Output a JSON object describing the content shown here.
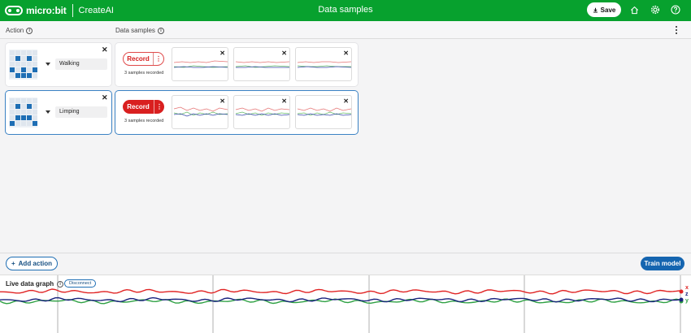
{
  "header": {
    "brand": "micro:bit",
    "product": "CreateAI",
    "title": "Data samples",
    "save_label": "Save"
  },
  "columns": {
    "action_label": "Action",
    "samples_label": "Data samples"
  },
  "actions": [
    {
      "name": "Walking",
      "record_label": "Record",
      "record_style": "outline",
      "samples_text": "3 samples recorded",
      "leds": [
        0,
        0,
        0,
        0,
        0,
        0,
        1,
        0,
        1,
        0,
        0,
        0,
        0,
        0,
        0,
        1,
        0,
        1,
        0,
        1,
        0,
        1,
        1,
        1,
        0
      ]
    },
    {
      "name": "Limping",
      "record_label": "Record",
      "record_style": "filled",
      "samples_text": "3 samples recorded",
      "leds": [
        0,
        0,
        0,
        0,
        0,
        0,
        1,
        0,
        1,
        0,
        0,
        0,
        0,
        0,
        0,
        0,
        1,
        1,
        1,
        0,
        1,
        0,
        0,
        0,
        1
      ]
    }
  ],
  "footer": {
    "add_action_label": "Add action",
    "train_label": "Train model"
  },
  "live_graph": {
    "title": "Live data graph",
    "disconnect_label": "Disconnect",
    "axes": [
      "x",
      "z",
      "y"
    ],
    "colors": {
      "x": "#e02424",
      "y": "#2ea043",
      "z": "#1a237e"
    }
  }
}
